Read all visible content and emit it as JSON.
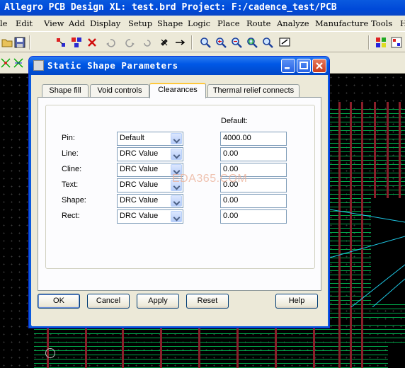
{
  "app": {
    "title": "Allegro PCB Design XL: test.brd  Project: F:/cadence_test/PCB"
  },
  "menu": {
    "items": [
      "le",
      "Edit",
      "View",
      "Add",
      "Display",
      "Setup",
      "Shape",
      "Logic",
      "Place",
      "Route",
      "Analyze",
      "Manufacture",
      "Tools",
      "H"
    ]
  },
  "toolbar": {
    "icons": [
      "folder-icon",
      "save-icon",
      "move-icon",
      "copy-icon",
      "delete-icon",
      "undo-icon",
      "redo-icon",
      "pin-icon",
      "arrow-icon",
      "zoom-icon",
      "zoom-in-icon",
      "zoom-out-icon",
      "zoom-fit-icon",
      "zoom-previous-icon",
      "redraw-icon"
    ]
  },
  "dialog": {
    "title": "Static Shape Parameters",
    "tabs": [
      "Shape fill",
      "Void controls",
      "Clearances",
      "Thermal relief connects"
    ],
    "active_tab": "Clearances",
    "default_header": "Default:",
    "rows": [
      {
        "label": "Pin:",
        "mode": "Default",
        "value": "4000.00"
      },
      {
        "label": "Line:",
        "mode": "DRC Value",
        "value": "0.00"
      },
      {
        "label": "Cline:",
        "mode": "DRC Value",
        "value": "0.00"
      },
      {
        "label": "Text:",
        "mode": "DRC Value",
        "value": "0.00"
      },
      {
        "label": "Shape:",
        "mode": "DRC Value",
        "value": "0.00"
      },
      {
        "label": "Rect:",
        "mode": "DRC Value",
        "value": "0.00"
      }
    ],
    "buttons": {
      "ok": "OK",
      "cancel": "Cancel",
      "apply": "Apply",
      "reset": "Reset",
      "help": "Help"
    },
    "watermark": "EDA365.COM"
  },
  "colors": {
    "title_bar": "#0058e6",
    "trace_green": "#00a84a",
    "trace_red": "#8a1f2a",
    "dialog_face": "#ece9d8"
  }
}
